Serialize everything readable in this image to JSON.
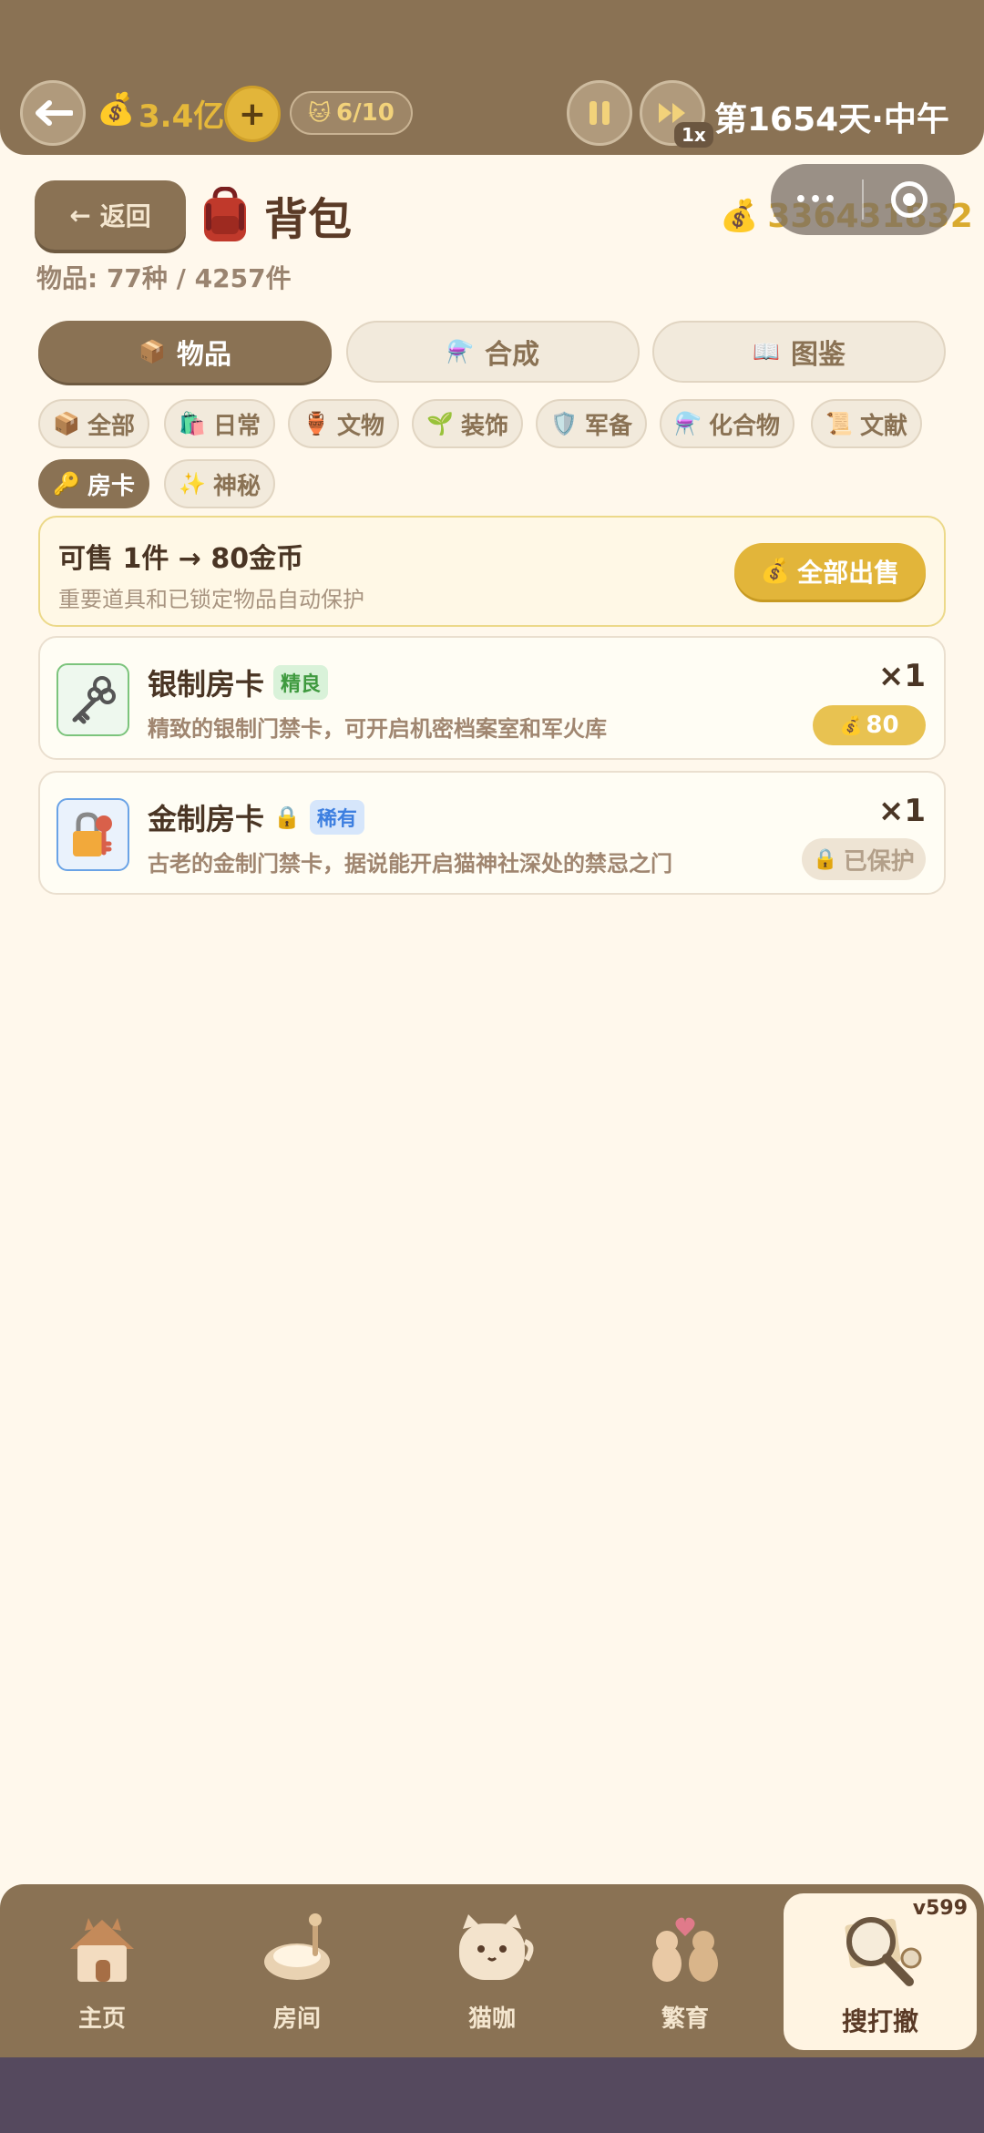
{
  "topbar": {
    "back_icon": "arrow-left-icon",
    "gold_short": "3.4亿",
    "plus_label": "+",
    "cats": "6/10",
    "speed": "1x",
    "day": "第1654天·中午"
  },
  "header": {
    "back_label": "返回",
    "title": "背包",
    "gold": "336431832",
    "stats": "物品: 77种 / 4257件"
  },
  "capsule": {
    "more_label": "•••"
  },
  "tabs": [
    {
      "label": "物品",
      "icon": "box-icon",
      "active": true
    },
    {
      "label": "合成",
      "icon": "flask-icon",
      "active": false
    },
    {
      "label": "图鉴",
      "icon": "book-icon",
      "active": false
    }
  ],
  "filters": [
    {
      "label": "全部",
      "icon": "box-icon"
    },
    {
      "label": "日常",
      "icon": "shopping-bag-icon"
    },
    {
      "label": "文物",
      "icon": "vase-icon"
    },
    {
      "label": "装饰",
      "icon": "plant-icon"
    },
    {
      "label": "军备",
      "icon": "shield-icon"
    },
    {
      "label": "化合物",
      "icon": "flask-icon"
    },
    {
      "label": "文献",
      "icon": "scroll-icon"
    },
    {
      "label": "房卡",
      "icon": "key-icon",
      "active": true
    },
    {
      "label": "神秘",
      "icon": "sparkles-icon"
    }
  ],
  "sell": {
    "title": "可售 1件 → 80金币",
    "subtitle": "重要道具和已锁定物品自动保护",
    "button": "全部出售"
  },
  "items": [
    {
      "name": "银制房卡",
      "rarity": "精良",
      "desc": "精致的银制门禁卡，可开启机密档案室和军火库",
      "qty": "×1",
      "price": "80",
      "locked": false
    },
    {
      "name": "金制房卡",
      "rarity": "稀有",
      "desc": "古老的金制门禁卡，据说能开启猫神社深处的禁忌之门",
      "qty": "×1",
      "protected_label": "已保护",
      "locked": true
    }
  ],
  "nav": {
    "items": [
      {
        "label": "主页",
        "icon": "house-icon"
      },
      {
        "label": "房间",
        "icon": "cat-bed-icon"
      },
      {
        "label": "猫咖",
        "icon": "cat-cup-icon"
      },
      {
        "label": "繁育",
        "icon": "cats-heart-icon"
      },
      {
        "label": "搜打撤",
        "icon": "magnifier-map-icon",
        "active": true
      }
    ],
    "version": "v599"
  },
  "colors": {
    "brand": "#8a7254",
    "gold": "#e2b53a",
    "background": "#fff8ec",
    "rarity_fine": "#4caf50",
    "rarity_rare": "#3d7fe0"
  }
}
